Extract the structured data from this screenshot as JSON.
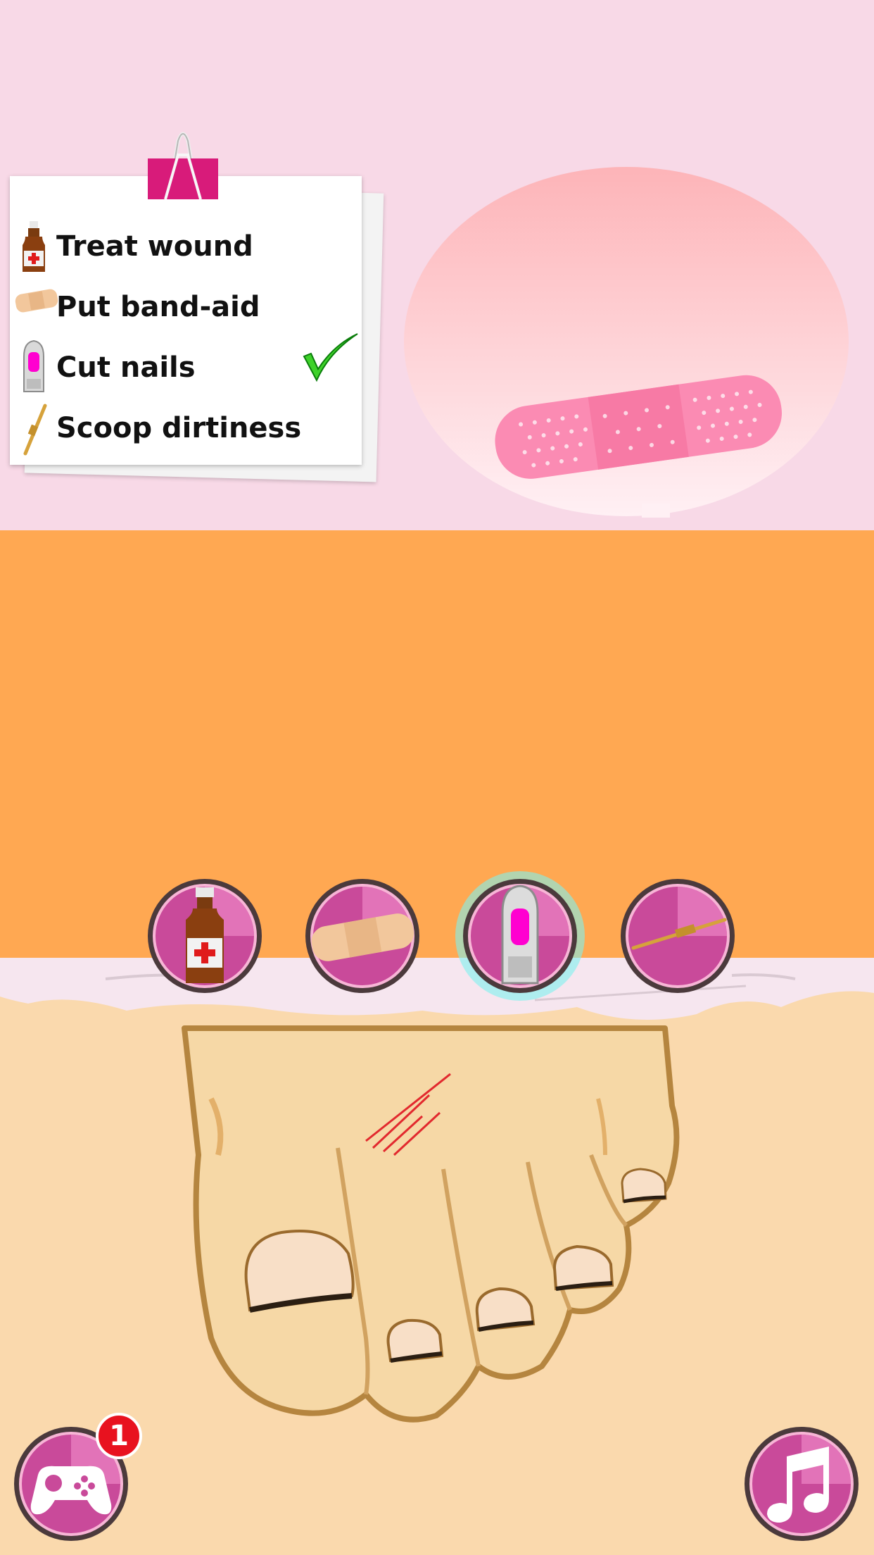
{
  "checklist": {
    "tasks": [
      {
        "label": "Treat wound",
        "icon": "medicine-bottle-icon",
        "done": false
      },
      {
        "label": "Put band-aid",
        "icon": "band-aid-icon",
        "done": false
      },
      {
        "label": "Cut nails",
        "icon": "nail-clipper-icon",
        "done": true
      },
      {
        "label": "Scoop dirtiness",
        "icon": "scoop-tool-icon",
        "done": false
      }
    ]
  },
  "preview": {
    "item": "band-aid"
  },
  "tools": [
    {
      "name": "medicine-bottle",
      "selected": false
    },
    {
      "name": "band-aid",
      "selected": false
    },
    {
      "name": "nail-clipper",
      "selected": true
    },
    {
      "name": "scoop-tool",
      "selected": false
    }
  ],
  "more_games": {
    "badge_count": "1"
  },
  "music": {
    "icon": "music-note-icon"
  },
  "colors": {
    "top_background": "#f8d9e7",
    "orange_band": "#ffa852",
    "skin": "#fad9ad",
    "button_pink": "#c94a9a",
    "check_green": "#3ed22a",
    "badge_red": "#e8121f"
  }
}
